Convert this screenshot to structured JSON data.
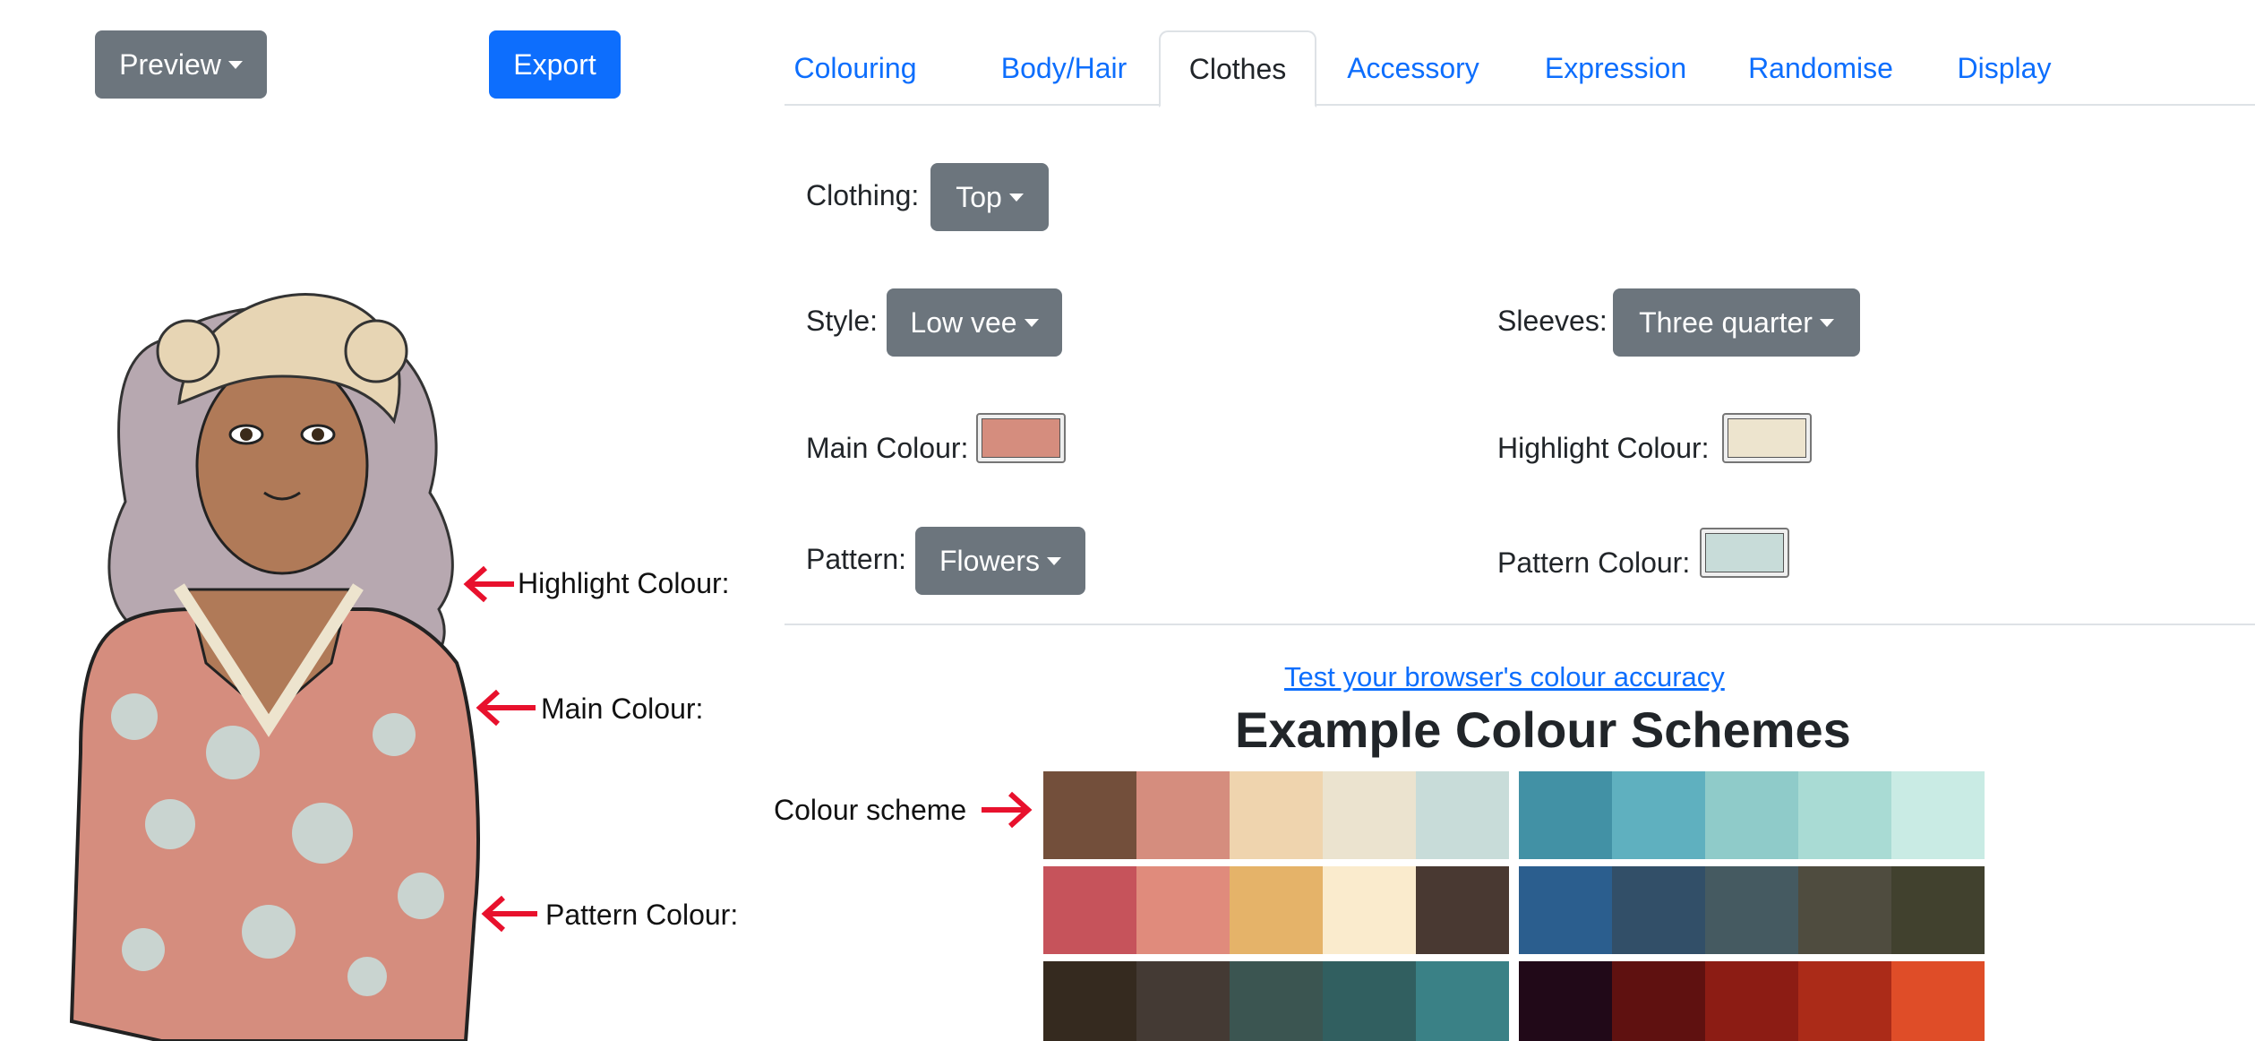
{
  "toolbar": {
    "preview_label": "Preview",
    "export_label": "Export"
  },
  "tabs": [
    {
      "label": "Colouring"
    },
    {
      "label": "Body/Hair"
    },
    {
      "label": "Clothes"
    },
    {
      "label": "Accessory"
    },
    {
      "label": "Expression"
    },
    {
      "label": "Randomise"
    },
    {
      "label": "Display"
    }
  ],
  "active_tab": "Clothes",
  "form": {
    "clothing": {
      "label": "Clothing:",
      "value": "Top"
    },
    "style": {
      "label": "Style:",
      "value": "Low vee"
    },
    "sleeves": {
      "label": "Sleeves:",
      "value": "Three quarter"
    },
    "main_colour": {
      "label": "Main Colour:",
      "color": "#d58d7e"
    },
    "highlight_colour": {
      "label": "Highlight Colour:",
      "color": "#ede4ce"
    },
    "pattern": {
      "label": "Pattern:",
      "value": "Flowers"
    },
    "pattern_colour": {
      "label": "Pattern Colour:",
      "color": "#c8dcd9"
    }
  },
  "schemes": {
    "link_text": "Test your browser's colour accuracy",
    "heading": "Example Colour Schemes",
    "palettes": [
      [
        "#734f3b",
        "#d58d7e",
        "#efd4ae",
        "#ebe3cf",
        "#c8dcd9"
      ],
      [
        "#4291a5",
        "#5fb0bf",
        "#8fcbc9",
        "#a9dbd4",
        "#c9ebe4"
      ],
      [
        "#c6535b",
        "#e08b7c",
        "#e5b369",
        "#faebcd",
        "#493932"
      ],
      [
        "#2b5e8e",
        "#324f68",
        "#455a61",
        "#4f4c3f",
        "#41412e"
      ],
      [
        "#352a1f",
        "#443a34",
        "#3b5551",
        "#315f60",
        "#3a8186"
      ],
      [
        "#210918",
        "#5f1110",
        "#8c1c14",
        "#ab2b18",
        "#df4d28"
      ]
    ]
  },
  "annotations": {
    "highlight": "Highlight Colour:",
    "main": "Main Colour:",
    "pattern": "Pattern Colour:",
    "scheme": "Colour scheme"
  },
  "colors": {
    "annotation_arrow": "#e8112d",
    "primary": "#0d6efd",
    "secondary": "#6c757d"
  }
}
